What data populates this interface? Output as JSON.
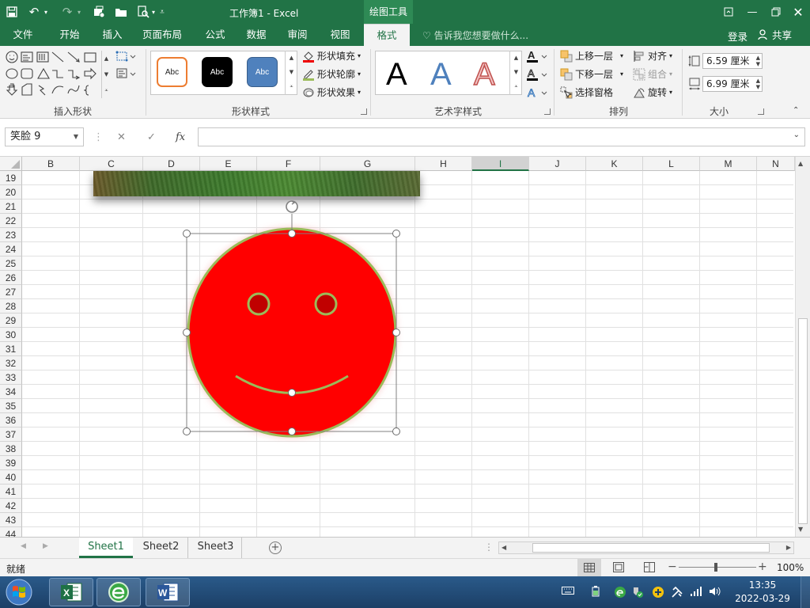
{
  "app": {
    "title": "工作簿1 - Excel",
    "context_tool": "绘图工具"
  },
  "tabs": [
    "文件",
    "开始",
    "插入",
    "页面布局",
    "公式",
    "数据",
    "审阅",
    "视图",
    "格式"
  ],
  "active_tab": "格式",
  "tell_me": "告诉我您想要做什么...",
  "account": {
    "login": "登录",
    "share": "共享"
  },
  "ribbon": {
    "groups": {
      "insert_shapes": "插入形状",
      "shape_styles": "形状样式",
      "wordart_styles": "艺术字样式",
      "arrange": "排列",
      "size": "大小"
    },
    "style_presets": [
      "Abc",
      "Abc",
      "Abc"
    ],
    "shape_fill": "形状填充",
    "shape_outline": "形状轮廓",
    "shape_effects": "形状效果",
    "wordart_letters": [
      "A",
      "A",
      "A"
    ],
    "bring_forward": "上移一层",
    "send_backward": "下移一层",
    "selection_pane": "选择窗格",
    "align": "对齐",
    "group": "组合",
    "rotate": "旋转",
    "height": "6.59 厘米",
    "width": "6.99 厘米"
  },
  "formula_bar": {
    "name_box": "笑脸 9",
    "cancel": "✕",
    "enter": "✓",
    "fx": "fx",
    "value": ""
  },
  "columns": [
    "B",
    "C",
    "D",
    "E",
    "F",
    "G",
    "H",
    "I",
    "J",
    "K",
    "L",
    "M",
    "N"
  ],
  "selected_column": "I",
  "rows": [
    "19",
    "20",
    "21",
    "22",
    "23",
    "24",
    "25",
    "26",
    "27",
    "28",
    "29",
    "30",
    "31",
    "32",
    "33",
    "34",
    "35",
    "36",
    "37",
    "38",
    "39",
    "40",
    "41",
    "42",
    "43",
    "44"
  ],
  "shape": {
    "fill": "#ff0000",
    "outline": "#9bbb59",
    "glow": "#f4a7a7",
    "eye_fill": "#c00000"
  },
  "sheets": [
    "Sheet1",
    "Sheet2",
    "Sheet3"
  ],
  "active_sheet": "Sheet1",
  "status": {
    "ready": "就绪",
    "zoom": "100%"
  },
  "taskbar": {
    "time": "13:35",
    "date": "2022-03-29"
  }
}
